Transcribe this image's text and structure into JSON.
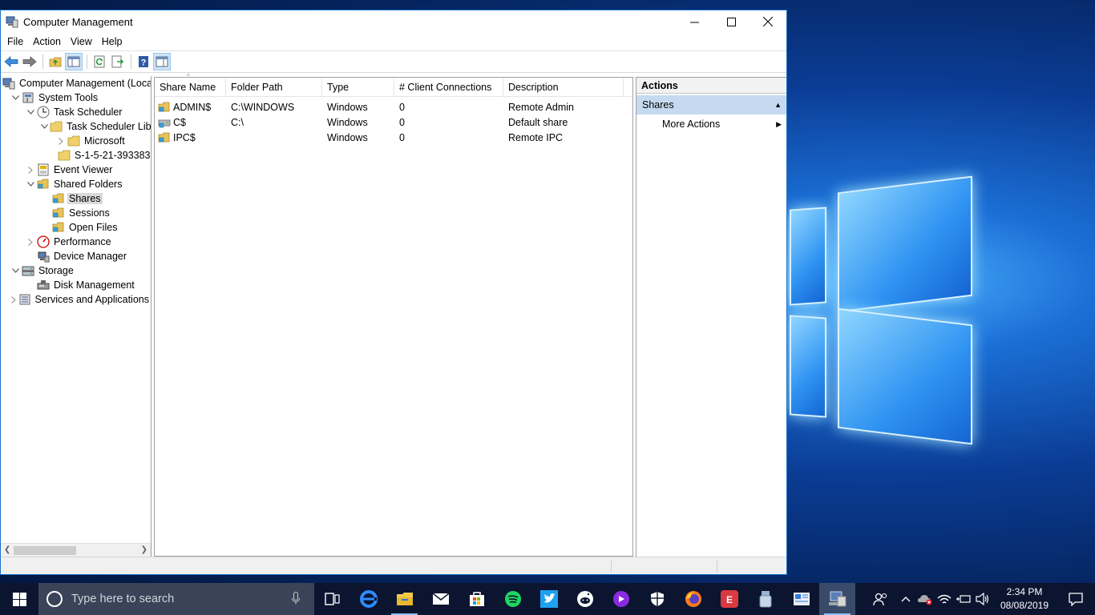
{
  "window": {
    "title": "Computer Management",
    "controls": {
      "minimize": "—",
      "maximize": "☐",
      "close": "✕"
    }
  },
  "menu": [
    "File",
    "Action",
    "View",
    "Help"
  ],
  "toolbar": {
    "buttons": [
      "back-icon",
      "forward-icon",
      "up-folder-icon",
      "show-hide-tree-icon",
      "refresh-icon",
      "export-list-icon",
      "help-icon",
      "show-hide-action-pane-icon"
    ]
  },
  "tree": {
    "items": [
      {
        "label": "Computer Management (Local",
        "level": 0,
        "expander": "",
        "icon": "computer-management-icon"
      },
      {
        "label": "System Tools",
        "level": 1,
        "expander": "expanded",
        "icon": "system-tools-icon"
      },
      {
        "label": "Task Scheduler",
        "level": 2,
        "expander": "expanded",
        "icon": "clock-icon"
      },
      {
        "label": "Task Scheduler Libra",
        "level": 3,
        "expander": "expanded",
        "icon": "folder-icon"
      },
      {
        "label": "Microsoft",
        "level": 4,
        "expander": "collapsed",
        "icon": "folder-icon"
      },
      {
        "label": "S-1-5-21-393383",
        "level": 4,
        "expander": "",
        "icon": "folder-icon"
      },
      {
        "label": "Event Viewer",
        "level": 2,
        "expander": "collapsed",
        "icon": "event-viewer-icon"
      },
      {
        "label": "Shared Folders",
        "level": 2,
        "expander": "expanded",
        "icon": "shared-folder-icon"
      },
      {
        "label": "Shares",
        "level": 3,
        "expander": "",
        "icon": "shared-folder-icon",
        "selected": true
      },
      {
        "label": "Sessions",
        "level": 3,
        "expander": "",
        "icon": "shared-folder-icon"
      },
      {
        "label": "Open Files",
        "level": 3,
        "expander": "",
        "icon": "shared-folder-icon"
      },
      {
        "label": "Performance",
        "level": 2,
        "expander": "collapsed",
        "icon": "performance-icon"
      },
      {
        "label": "Device Manager",
        "level": 2,
        "expander": "",
        "icon": "device-manager-icon"
      },
      {
        "label": "Storage",
        "level": 1,
        "expander": "expanded",
        "icon": "storage-icon"
      },
      {
        "label": "Disk Management",
        "level": 2,
        "expander": "",
        "icon": "disk-management-icon"
      },
      {
        "label": "Services and Applications",
        "level": 1,
        "expander": "collapsed",
        "icon": "services-icon"
      }
    ]
  },
  "list": {
    "columns": [
      "Share Name",
      "Folder Path",
      "Type",
      "# Client Connections",
      "Description"
    ],
    "rows": [
      {
        "name": "ADMIN$",
        "path": "C:\\WINDOWS",
        "type": "Windows",
        "connections": "0",
        "description": "Remote Admin"
      },
      {
        "name": "C$",
        "path": "C:\\",
        "type": "Windows",
        "connections": "0",
        "description": "Default share"
      },
      {
        "name": "IPC$",
        "path": "",
        "type": "Windows",
        "connections": "0",
        "description": "Remote IPC"
      }
    ]
  },
  "actions": {
    "title": "Actions",
    "section": "Shares",
    "items": [
      "More Actions"
    ]
  },
  "taskbar": {
    "search_placeholder": "Type here to search",
    "apps": [
      "task-view-icon",
      "edge-icon",
      "file-explorer-icon",
      "mail-icon",
      "store-icon",
      "spotify-icon",
      "twitter-icon",
      "reddit-icon",
      "podcast-icon",
      "security-icon",
      "firefox-icon",
      "expressvpn-icon",
      "usb-icon",
      "news-icon",
      "computer-management-icon"
    ],
    "clock_time": "2:34 PM",
    "clock_date": "08/08/2019"
  },
  "colors": {
    "selection": "#d9d9d9",
    "actions_section": "#c5daf0",
    "taskbar": "#0b1530",
    "search_box": "#3a4458"
  }
}
